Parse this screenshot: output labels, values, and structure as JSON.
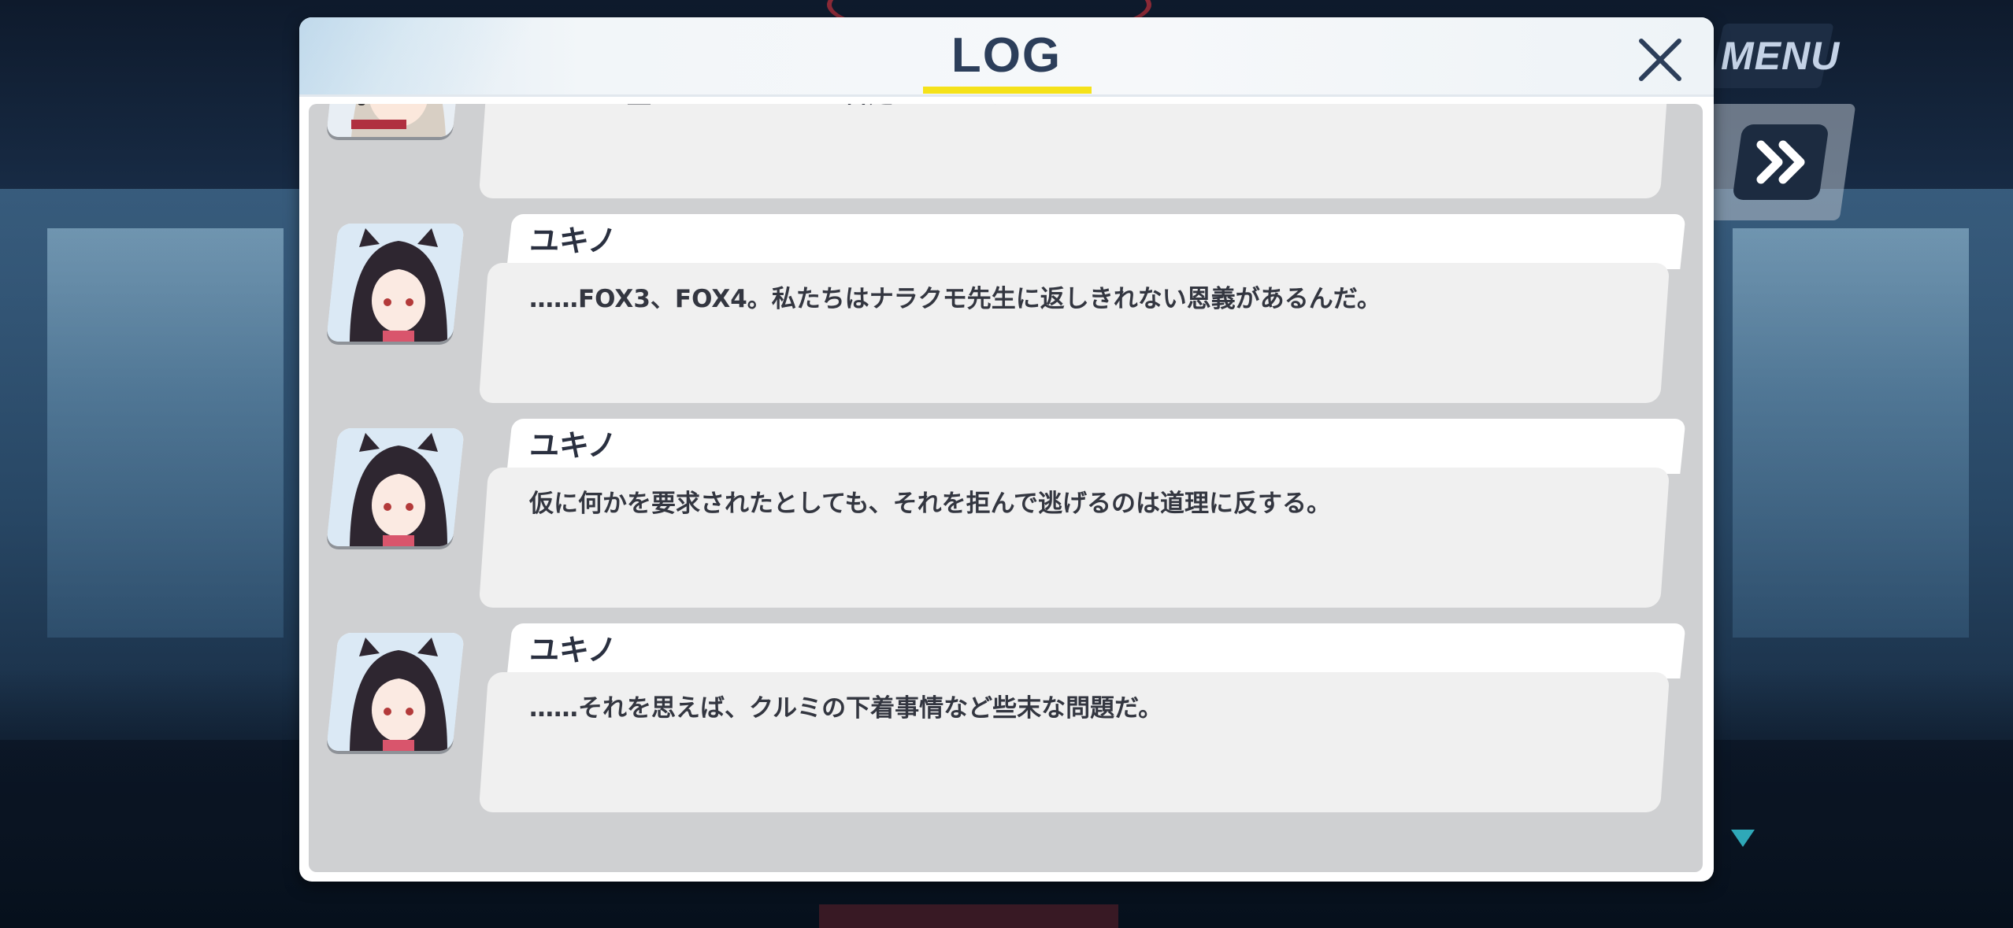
{
  "menu": {
    "label": "MENU"
  },
  "controls": {
    "fast_forward": "fast-forward-icon",
    "next_indicator": "down-triangle-icon"
  },
  "log": {
    "title": "LOG",
    "close": "close-icon",
    "entries": [
      {
        "name": "",
        "text": "ほう……盛ってるってことは否定しないんだね？",
        "portrait": "headset-girl-portrait"
      },
      {
        "name": "ユキノ",
        "text": "……FOX3、FOX4。私たちはナラクモ先生に返しきれない恩義があるんだ。",
        "portrait": "yukino-portrait"
      },
      {
        "name": "ユキノ",
        "text": "仮に何かを要求されたとしても、それを拒んで逃げるのは道理に反する。",
        "portrait": "yukino-portrait"
      },
      {
        "name": "ユキノ",
        "text": "……それを思えば、クルミの下着事情など些末な問題だ。",
        "portrait": "yukino-portrait"
      }
    ]
  },
  "colors": {
    "title": "#2c3e5a",
    "underline": "#f5e21a",
    "log_bg": "#cfd0d2",
    "bubble": "#f0f0f0"
  }
}
